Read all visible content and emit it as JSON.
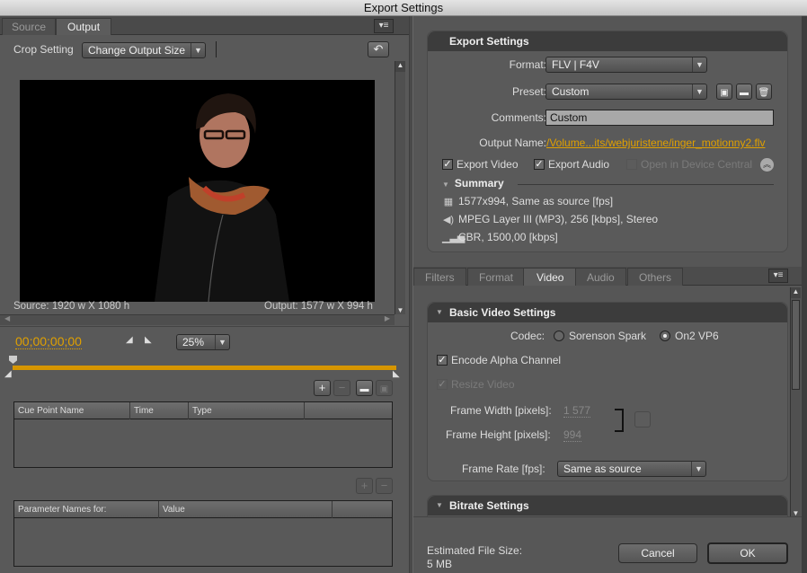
{
  "window": {
    "title": "Export Settings"
  },
  "left": {
    "tabs": [
      {
        "label": "Source",
        "active": false
      },
      {
        "label": "Output",
        "active": true
      }
    ],
    "panel_menu_icon": "panel-menu-icon",
    "crop_setting": {
      "label": "Crop Setting",
      "value": "Change Output Size"
    },
    "undo_icon": "undo-arrow-icon",
    "source_size": "Source: 1920 w X 1080 h",
    "output_size": "Output: 1577 w X 994 h",
    "timecode": "00;00;00;00",
    "zoom": "25%",
    "cue_table": {
      "columns": [
        "Cue Point Name",
        "Time",
        "Type",
        ""
      ],
      "rows": []
    },
    "param_table": {
      "columns": [
        "Parameter Names for:",
        "Value",
        ""
      ],
      "rows": []
    }
  },
  "right": {
    "export_settings": {
      "title": "Export Settings",
      "format_label": "Format:",
      "format_value": "FLV | F4V",
      "preset_label": "Preset:",
      "preset_value": "Custom",
      "comments_label": "Comments:",
      "comments_value": "Custom",
      "output_name_label": "Output Name:",
      "output_name_value": "/Volume...its/webjuristene/inger_motionny2.flv",
      "export_video": {
        "label": "Export Video",
        "checked": true
      },
      "export_audio": {
        "label": "Export Audio",
        "checked": true
      },
      "device_central": {
        "label": "Open in Device Central",
        "checked": false,
        "enabled": false
      },
      "summary": {
        "title": "Summary",
        "video": "1577x994, Same as source [fps]",
        "audio": "MPEG Layer III (MP3), 256 [kbps], Stereo",
        "bitrate": "CBR, 1500,00 [kbps]"
      }
    },
    "tabs": [
      {
        "label": "Filters",
        "active": false
      },
      {
        "label": "Format",
        "active": false
      },
      {
        "label": "Video",
        "active": true
      },
      {
        "label": "Audio",
        "active": false
      },
      {
        "label": "Others",
        "active": false
      }
    ],
    "basic_video": {
      "title": "Basic Video Settings",
      "codec_label": "Codec:",
      "codec_options": [
        {
          "label": "Sorenson Spark",
          "selected": false
        },
        {
          "label": "On2 VP6",
          "selected": true
        }
      ],
      "encode_alpha": {
        "label": "Encode Alpha Channel",
        "checked": true
      },
      "resize_video": {
        "label": "Resize Video",
        "checked": true,
        "enabled": false
      },
      "frame_width_label": "Frame Width [pixels]:",
      "frame_width_value": "1 577",
      "frame_height_label": "Frame Height [pixels]:",
      "frame_height_value": "994",
      "frame_rate_label": "Frame Rate [fps]:",
      "frame_rate_value": "Same as source"
    },
    "bitrate": {
      "title": "Bitrate Settings"
    },
    "footer": {
      "est_label": "Estimated File Size:",
      "est_value": "5 MB",
      "cancel": "Cancel",
      "ok": "OK"
    }
  },
  "colors": {
    "accent": "#e0a000",
    "panel": "#595959",
    "header": "#3c3c3c"
  }
}
